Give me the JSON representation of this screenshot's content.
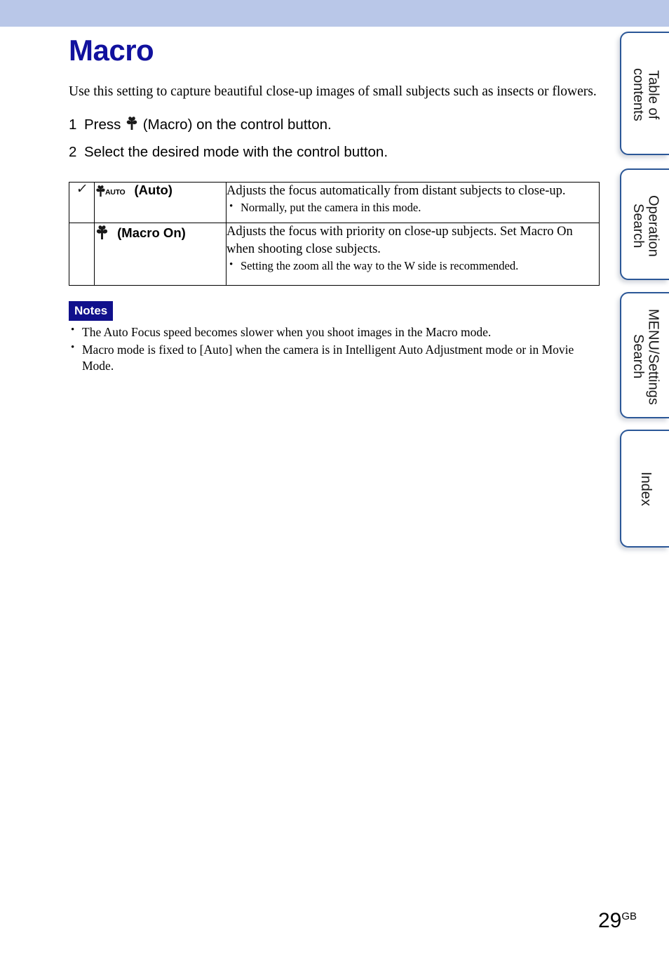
{
  "header": {
    "band_color": "#b9c7e8"
  },
  "document": {
    "title": "Macro",
    "title_color": "#11119e",
    "intro": "Use this setting to capture beautiful close-up images of small subjects such as insects or flowers."
  },
  "steps": [
    {
      "number": "1",
      "text_before": "Press ",
      "icon": "macro-flower-icon",
      "text_after": " (Macro) on the control button."
    },
    {
      "number": "2",
      "text_before": "Select the desired mode with the control button.",
      "icon": "",
      "text_after": ""
    }
  ],
  "mode_table": {
    "rows": [
      {
        "selected_marker": "✓",
        "is_default": true,
        "icon": "macro-auto-icon",
        "icon_sub_label": "AUTO",
        "mode_label": "(Auto)",
        "description": "Adjusts the focus automatically from distant subjects to close-up.",
        "bullets": [
          "Normally, put the camera in this mode."
        ]
      },
      {
        "selected_marker": "",
        "is_default": false,
        "icon": "macro-flower-icon",
        "icon_sub_label": "",
        "mode_label": "(Macro On)",
        "description": "Adjusts the focus with priority on close-up subjects. Set Macro On when shooting close subjects.",
        "bullets": [
          "Setting the zoom all the way to the W side is recommended."
        ]
      }
    ]
  },
  "notes": {
    "badge_label": "Notes",
    "badge_color": "#10108c",
    "items": [
      "The Auto Focus speed becomes slower when you shoot images in the Macro mode.",
      "Macro mode is fixed to [Auto] when the camera is in Intelligent Auto Adjustment mode or in Movie Mode."
    ]
  },
  "side_tabs": [
    {
      "label": "Table of\ncontents"
    },
    {
      "label": "Operation\nSearch"
    },
    {
      "label": "MENU/Settings\nSearch"
    },
    {
      "label": "Index"
    }
  ],
  "footer": {
    "page_number": "29",
    "page_suffix": "GB"
  }
}
